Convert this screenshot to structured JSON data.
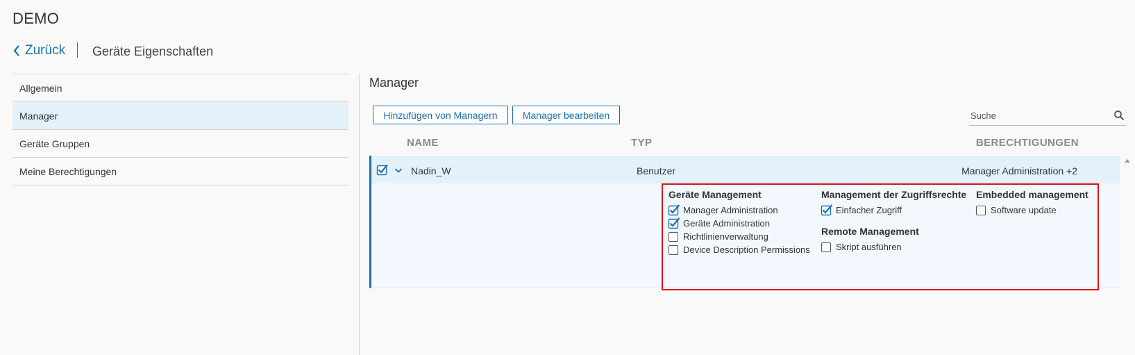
{
  "app": {
    "title": "DEMO"
  },
  "header": {
    "back_label": "Zurück",
    "page_title": "Geräte Eigenschaften"
  },
  "sidebar": {
    "items": [
      {
        "label": "Allgemein",
        "active": false
      },
      {
        "label": "Manager",
        "active": true
      },
      {
        "label": "Geräte Gruppen",
        "active": false
      },
      {
        "label": "Meine Berechtigungen",
        "active": false
      }
    ]
  },
  "main": {
    "section_title": "Manager",
    "buttons": {
      "add": "Hinzufügen von Managern",
      "edit": "Manager bearbeiten"
    },
    "search": {
      "placeholder": "Suche",
      "value": ""
    },
    "columns": {
      "name": "NAME",
      "type": "TYP",
      "permissions": "BERECHTIGUNGEN"
    },
    "rows": [
      {
        "name": "Nadin_W",
        "type": "Benutzer",
        "permissions": "Manager Administration +2",
        "selected": true,
        "expanded": true
      }
    ],
    "permission_groups": {
      "device": {
        "title": "Geräte Management",
        "options": [
          {
            "label": "Manager Administration",
            "checked": true
          },
          {
            "label": "Geräte Administration",
            "checked": true
          },
          {
            "label": "Richtlinienverwaltung",
            "checked": false
          },
          {
            "label": "Device Description Permissions",
            "checked": false
          }
        ]
      },
      "access": {
        "title": "Management der Zugriffsrechte",
        "options": [
          {
            "label": "Einfacher Zugriff",
            "checked": true
          }
        ]
      },
      "remote": {
        "title": "Remote Management",
        "options": [
          {
            "label": "Skript ausführen",
            "checked": false
          }
        ]
      },
      "embedded": {
        "title": "Embedded management",
        "options": [
          {
            "label": "Software update",
            "checked": false
          }
        ]
      }
    }
  },
  "colors": {
    "accent": "#1a6fb3",
    "selected_row": "#e3f1fb",
    "highlight_border": "#d9141e"
  }
}
